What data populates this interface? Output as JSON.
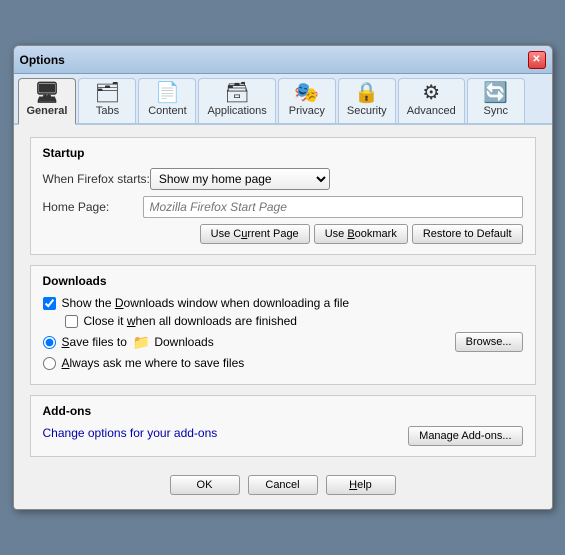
{
  "window": {
    "title": "Options",
    "close_label": "✕"
  },
  "tabs": [
    {
      "id": "general",
      "label": "General",
      "icon": "🖥",
      "active": true
    },
    {
      "id": "tabs",
      "label": "Tabs",
      "icon": "🗂"
    },
    {
      "id": "content",
      "label": "Content",
      "icon": "📄"
    },
    {
      "id": "applications",
      "label": "Applications",
      "icon": "🗃"
    },
    {
      "id": "privacy",
      "label": "Privacy",
      "icon": "🎭"
    },
    {
      "id": "security",
      "label": "Security",
      "icon": "🔒"
    },
    {
      "id": "advanced",
      "label": "Advanced",
      "icon": "⚙"
    },
    {
      "id": "sync",
      "label": "Sync",
      "icon": "🔄"
    }
  ],
  "startup": {
    "section_label": "Startup",
    "when_label": "When Firefox starts:",
    "dropdown_value": "Show my home page",
    "home_label": "Home Page:",
    "home_placeholder": "Mozilla Firefox Start Page",
    "use_current_label": "Use Current Page",
    "use_bookmark_label": "Use Bookmark",
    "restore_label": "Restore to Default"
  },
  "downloads": {
    "section_label": "Downloads",
    "show_window_label": "Show the Downloads window when downloading a file",
    "close_label": "Close it when all downloads are finished",
    "save_files_label": "Save files to",
    "folder_icon": "📁",
    "folder_path": "Downloads",
    "browse_label": "Browse...",
    "ask_label": "Always ask me where to save files"
  },
  "addons": {
    "section_label": "Add-ons",
    "desc_label": "Change options for your add-ons",
    "manage_label": "Manage Add-ons..."
  },
  "footer": {
    "ok_label": "OK",
    "cancel_label": "Cancel",
    "help_label": "Help"
  }
}
